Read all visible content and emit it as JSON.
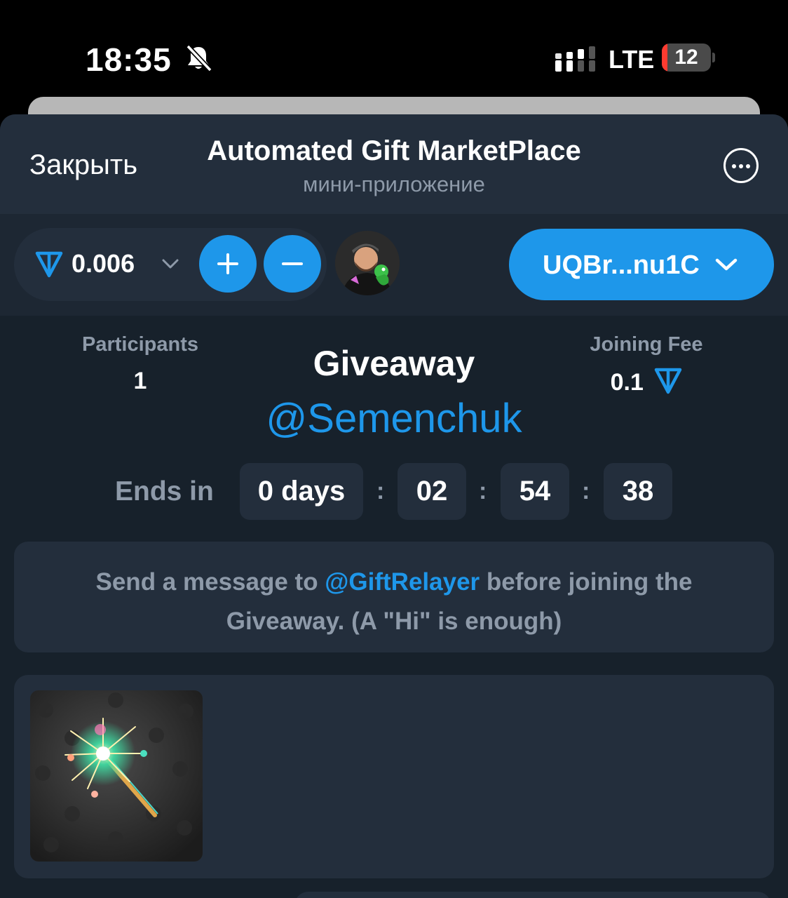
{
  "status_bar": {
    "time": "18:35",
    "silent_icon": "bell-slash-icon",
    "signal_icon": "cellular-signal-icon",
    "network": "LTE",
    "battery_level": "12",
    "battery_fraction": 0.12,
    "battery_color": "#ff3b30"
  },
  "header": {
    "close_label": "Закрыть",
    "title": "Automated Gift MarketPlace",
    "subtitle": "мини-приложение",
    "more_icon": "more-horizontal-icon"
  },
  "wallet": {
    "currency_icon": "ton-icon",
    "balance": "0.006",
    "dropdown_icon": "chevron-down-icon",
    "add_icon": "plus-icon",
    "remove_icon": "minus-icon",
    "avatar_icon": "user-avatar",
    "address": "UQBr...nu1C",
    "accent_color": "#1e97ea"
  },
  "giveaway": {
    "participants_label": "Participants",
    "participants_value": "1",
    "title": "Giveaway",
    "host": "@Semenchuk",
    "fee_label": "Joining Fee",
    "fee_value": "0.1",
    "ends_label": "Ends in",
    "timer": {
      "days": "0 days",
      "hours": "02",
      "minutes": "54",
      "seconds": "38",
      "separator": ":"
    }
  },
  "notice": {
    "before": "Send a message to ",
    "link": "@GiftRelayer",
    "after": " before joining the Giveaway. (A \"Hi\" is enough)"
  },
  "gift": {
    "icon": "sparkler-icon"
  }
}
